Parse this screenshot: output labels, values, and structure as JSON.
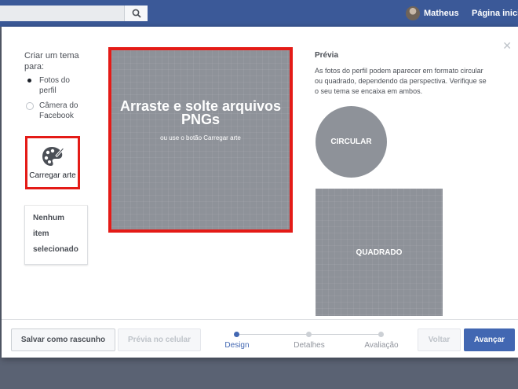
{
  "topbar": {
    "search_icon": "search-icon",
    "user_name": "Matheus",
    "home_link": "Página inicial"
  },
  "modal": {
    "close_icon": "close-icon",
    "left": {
      "title": "Criar um tema para:",
      "options": [
        {
          "label": "Fotos do perfil",
          "checked": true
        },
        {
          "label": "Câmera do Facebook",
          "checked": false
        }
      ],
      "upload_icon": "palette-icon",
      "upload_label": "Carregar arte",
      "selection_text": "Nenhum item selecionado"
    },
    "dropzone": {
      "title": "Arraste e solte arquivos PNGs",
      "subtitle": "ou use o botão Carregar arte"
    },
    "preview": {
      "title": "Prévia",
      "description": "As fotos do perfil podem aparecer em formato circular ou quadrado, dependendo da perspectiva. Verifique se o seu tema se encaixa em ambos.",
      "circle_label": "CIRCULAR",
      "square_label": "QUADRADO"
    },
    "footer": {
      "save_draft": "Salvar como rascunho",
      "mobile_preview": "Prévia no celular",
      "steps": [
        {
          "label": "Design",
          "active": true
        },
        {
          "label": "Detalhes",
          "active": false
        },
        {
          "label": "Avaliação",
          "active": false
        }
      ],
      "back": "Voltar",
      "next": "Avançar"
    }
  },
  "colors": {
    "brand": "#3b5998",
    "primary_button": "#4267b2",
    "highlight_border": "#e41b17",
    "placeholder_gray": "#8e9299"
  }
}
